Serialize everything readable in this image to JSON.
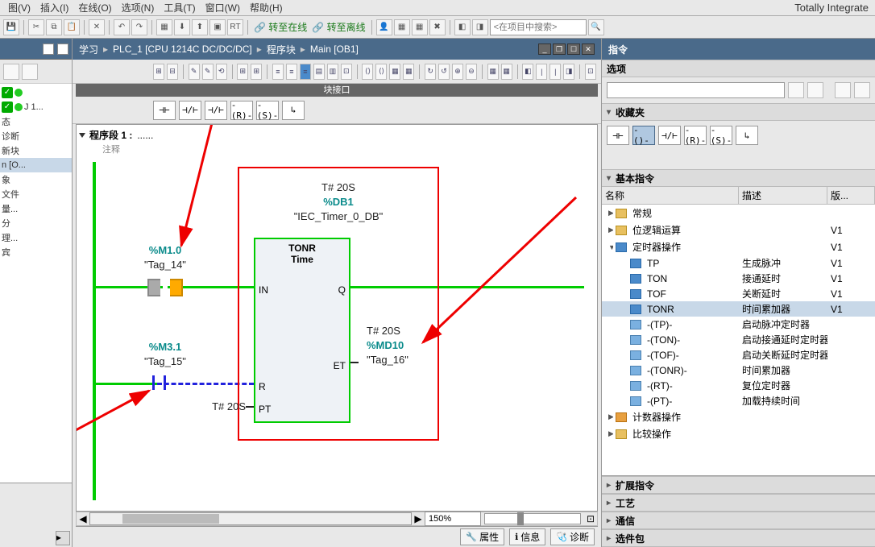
{
  "brand": "Totally Integrate",
  "menu": [
    "图(V)",
    "插入(I)",
    "在线(O)",
    "选项(N)",
    "工具(T)",
    "窗口(W)",
    "帮助(H)"
  ],
  "toolbar_links": {
    "online": "转至在线",
    "offline": "转至离线"
  },
  "search_placeholder": "<在项目中搜索>",
  "breadcrumb": [
    "学习",
    "PLC_1 [CPU 1214C DC/DC/DC]",
    "程序块",
    "Main [OB1]"
  ],
  "block_interface": "块接口",
  "ladder_buttons": [
    "⊣⊢",
    "⊣/⊢",
    "⊣/⊢",
    "-(R)-",
    "-(S)-",
    "↳"
  ],
  "network": {
    "title": "程序段 1 :",
    "dots": "......",
    "comment": "注释"
  },
  "timer": {
    "t_value": "T# 20S",
    "db": "%DB1",
    "db_name": "\"IEC_Timer_0_DB\"",
    "type": "TONR",
    "sub": "Time",
    "pins": {
      "IN": "IN",
      "Q": "Q",
      "R": "R",
      "ET": "ET",
      "PT": "PT"
    },
    "pt_val": "T# 20S"
  },
  "tags": {
    "tag14_addr": "%M1.0",
    "tag14_name": "\"Tag_14\"",
    "tag15_addr": "%M3.1",
    "tag15_name": "\"Tag_15\"",
    "tag16_pre": "T# 20S",
    "tag16_addr": "%MD10",
    "tag16_name": "\"Tag_16\""
  },
  "zoom": "150%",
  "status_tabs": [
    "属性",
    "信息",
    "诊断"
  ],
  "left_items": [
    "",
    "J 1...",
    "态",
    "诊断",
    "新块",
    "n [O...",
    "象",
    "文件",
    "量...",
    "分",
    "理...",
    "宾"
  ],
  "right": {
    "title": "指令",
    "sections": {
      "options": "选项",
      "fav": "收藏夹",
      "basic": "基本指令",
      "ext": "扩展指令",
      "tech": "工艺",
      "comm": "通信",
      "opt": "选件包"
    },
    "tree_hdr": [
      "名称",
      "描述",
      "版..."
    ],
    "fav_buttons": [
      "⊣⊢",
      "-()-",
      "⊣/⊢",
      "-(R)-",
      "-(S)-",
      "↳"
    ],
    "tree": [
      {
        "lvl": 0,
        "exp": "▶",
        "icon": "ic-folder",
        "name": "常规",
        "desc": "",
        "ver": ""
      },
      {
        "lvl": 0,
        "exp": "▶",
        "icon": "ic-folder",
        "name": "位逻辑运算",
        "desc": "",
        "ver": "V1"
      },
      {
        "lvl": 0,
        "exp": "▼",
        "icon": "ic-timer",
        "name": "定时器操作",
        "desc": "",
        "ver": "V1"
      },
      {
        "lvl": 1,
        "exp": "",
        "icon": "ic-timer",
        "name": "TP",
        "desc": "生成脉冲",
        "ver": "V1"
      },
      {
        "lvl": 1,
        "exp": "",
        "icon": "ic-timer",
        "name": "TON",
        "desc": "接通延时",
        "ver": "V1"
      },
      {
        "lvl": 1,
        "exp": "",
        "icon": "ic-timer",
        "name": "TOF",
        "desc": "关断延时",
        "ver": "V1"
      },
      {
        "lvl": 1,
        "exp": "",
        "icon": "ic-timer",
        "name": "TONR",
        "desc": "时间累加器",
        "ver": "V1",
        "sel": true
      },
      {
        "lvl": 1,
        "exp": "",
        "icon": "ic-timer2",
        "name": "-(TP)-",
        "desc": "启动脉冲定时器",
        "ver": ""
      },
      {
        "lvl": 1,
        "exp": "",
        "icon": "ic-timer2",
        "name": "-(TON)-",
        "desc": "启动接通延时定时器",
        "ver": ""
      },
      {
        "lvl": 1,
        "exp": "",
        "icon": "ic-timer2",
        "name": "-(TOF)-",
        "desc": "启动关断延时定时器",
        "ver": ""
      },
      {
        "lvl": 1,
        "exp": "",
        "icon": "ic-timer2",
        "name": "-(TONR)-",
        "desc": "时间累加器",
        "ver": ""
      },
      {
        "lvl": 1,
        "exp": "",
        "icon": "ic-timer2",
        "name": "-(RT)-",
        "desc": "复位定时器",
        "ver": ""
      },
      {
        "lvl": 1,
        "exp": "",
        "icon": "ic-timer2",
        "name": "-(PT)-",
        "desc": "加载持续时间",
        "ver": ""
      },
      {
        "lvl": 0,
        "exp": "▶",
        "icon": "ic-cnt",
        "name": "计数器操作",
        "desc": "",
        "ver": ""
      },
      {
        "lvl": 0,
        "exp": "▶",
        "icon": "ic-folder",
        "name": "比较操作",
        "desc": "",
        "ver": ""
      }
    ]
  }
}
